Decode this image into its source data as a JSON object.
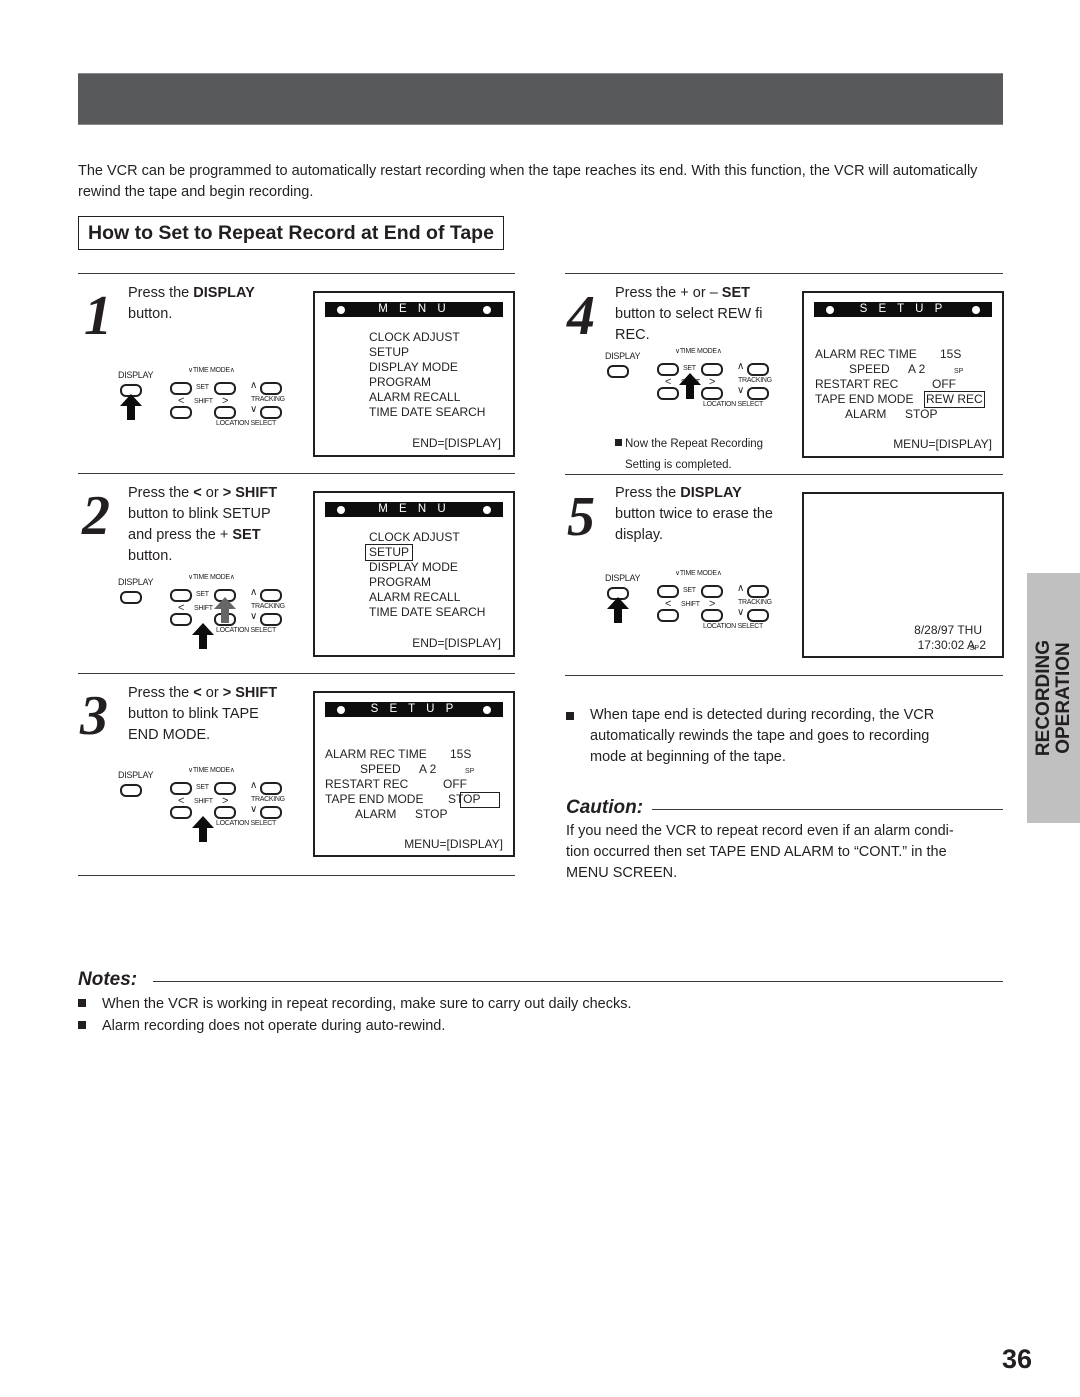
{
  "intro": "The VCR can be programmed to automatically restart recording when the tape reaches its end. With this function, the VCR will automatically rewind the tape and begin recording.",
  "section_title": "How to Set to Repeat Record at End of Tape",
  "remote_labels": {
    "display": "DISPLAY",
    "time_mode": "TIME MODE",
    "set": "SET",
    "shift": "SHIFT",
    "tracking": "TRACKING",
    "location_select": "LOCATION SELECT"
  },
  "steps": [
    {
      "number": "1",
      "text_parts": [
        "Press the ",
        "DISPLAY",
        " button."
      ],
      "screen": {
        "title": "M E N U",
        "lines": [
          "CLOCK ADJUST",
          "SETUP",
          "DISPLAY MODE",
          "PROGRAM",
          "ALARM RECALL",
          "TIME DATE SEARCH"
        ],
        "footer": "END=[DISPLAY]"
      }
    },
    {
      "number": "2",
      "text_line1_a": "Press the ",
      "text_line1_b": " or ",
      "text_line1_c": "SHIFT",
      "text_line2": "button to blink SETUP",
      "text_line3_a": "and press the + ",
      "text_line3_b": "SET",
      "text_line4": "button.",
      "screen": {
        "title": "M E N U",
        "lines": [
          "CLOCK ADJUST",
          "SETUP",
          "DISPLAY MODE",
          "PROGRAM",
          "ALARM RECALL",
          "TIME DATE SEARCH"
        ],
        "highlighted": "SETUP",
        "footer": "END=[DISPLAY]"
      }
    },
    {
      "number": "3",
      "text_line1_a": "Press the ",
      "text_line1_b": " or ",
      "text_line1_c": "SHIFT",
      "text_line2": "button to blink TAPE",
      "text_line3": "END MODE.",
      "screen": {
        "title": "S E T U P",
        "rows": [
          {
            "label": "ALARM REC TIME",
            "value": "15S"
          },
          {
            "label": "SPEED",
            "value": "A 2",
            "sub": "SP"
          },
          {
            "label": "RESTART REC",
            "value": "OFF"
          },
          {
            "label": "TAPE END MODE",
            "value": "STOP"
          },
          {
            "label": "ALARM",
            "value": "STOP"
          }
        ],
        "footer": "MENU=[DISPLAY]"
      }
    },
    {
      "number": "4",
      "text_line1_a": "Press the + or – ",
      "text_line1_b": "SET",
      "text_line2": "button to select REW fi",
      "text_line3": "REC.",
      "note": "Now the Repeat Recording Setting is completed.",
      "note_line1": "Now the Repeat Recording",
      "note_line2": "Setting is completed.",
      "screen": {
        "title": "S E T U P",
        "rows": [
          {
            "label": "ALARM REC TIME",
            "value": "15S"
          },
          {
            "label": "SPEED",
            "value": "A 2",
            "sub": "SP"
          },
          {
            "label": "RESTART REC",
            "value": "OFF"
          },
          {
            "label": "TAPE END MODE",
            "value": "REW REC"
          },
          {
            "label": "ALARM",
            "value": "STOP"
          }
        ],
        "footer": "MENU=[DISPLAY]"
      }
    },
    {
      "number": "5",
      "text_line1_a": "Press the ",
      "text_line1_b": "DISPLAY",
      "text_line2": "button twice to erase the",
      "text_line3": "display.",
      "screen": {
        "date": "8/28/97 THU",
        "time": "17:30:02 A",
        "speed_sub": "SP",
        "speed_num": "2"
      }
    }
  ],
  "result_bullet": "When tape end is detected during recording, the VCR automatically rewinds the tape and goes to recording mode at beginning of the tape.",
  "result_bullet_lines": [
    "When tape end is detected during recording, the VCR",
    "automatically rewinds the tape and goes to recording",
    "mode at beginning of the tape."
  ],
  "caution": {
    "heading": "Caution:",
    "lines": [
      "If you need the VCR to repeat record even if an alarm condi-",
      "tion occurred then set TAPE END ALARM to “CONT.” in the",
      "MENU SCREEN."
    ]
  },
  "notes": {
    "heading": "Notes:",
    "items": [
      "When the VCR is working in repeat recording, make sure to carry out daily checks.",
      "Alarm recording does not operate during auto-rewind."
    ]
  },
  "side_tab": {
    "line1": "RECORDING",
    "line2": "OPERATION"
  },
  "page_number": "36",
  "colors": {
    "header_bar": "#58595b",
    "side_tab": "#c0c0c1",
    "text": "#231f20"
  }
}
